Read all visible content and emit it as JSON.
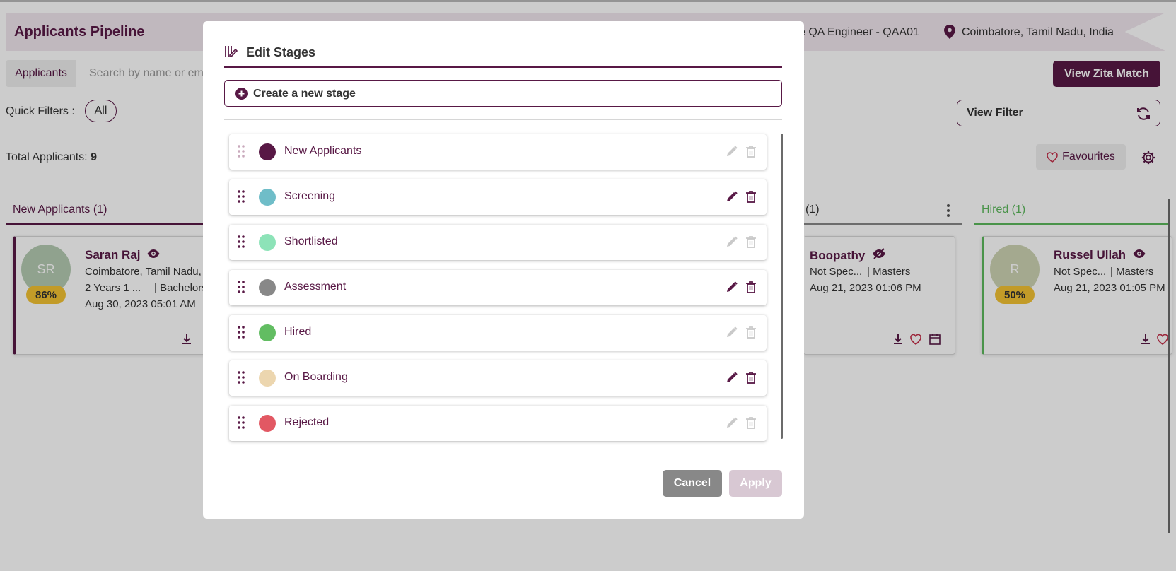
{
  "header": {
    "title": "Applicants Pipeline",
    "job": "e QA Engineer - QAA01",
    "location": "Coimbatore, Tamil Nadu, India"
  },
  "toolbar": {
    "tab": "Applicants",
    "search_placeholder": "Search by name or em",
    "view_zita_match": "View Zita Match",
    "quick_filters_label": "Quick Filters :",
    "quick_filter_all": "All",
    "view_filter": "View Filter",
    "total_label": "Total Applicants:",
    "total_count": "9",
    "favourites": "Favourites"
  },
  "columns": [
    {
      "label": "New Applicants (1)",
      "color": "#581845"
    },
    {
      "label": "(1)",
      "color": "#888888"
    },
    {
      "label": "Hired (1)",
      "color": "#5cb85c"
    }
  ],
  "cards": [
    {
      "initials": "SR",
      "score": "86%",
      "name": "Saran Raj",
      "line1": "Coimbatore, Tamil Nadu,",
      "line2": "2 Years 1 ...",
      "line2b": "| Bachelors",
      "date": "Aug 30, 2023 05:01 AM"
    },
    {
      "name": "Boopathy",
      "line1": "Not Spec...",
      "line1b": "| Masters",
      "date": "Aug 21, 2023 01:06 PM"
    },
    {
      "initials": "R",
      "score": "50%",
      "name": "Russel Ullah",
      "line1": "Not Spec...",
      "line1b": "| Masters",
      "date": "Aug 21, 2023 01:05 PM"
    }
  ],
  "modal": {
    "title": "Edit Stages",
    "create_label": "Create a new stage",
    "cancel": "Cancel",
    "apply": "Apply",
    "stages": [
      {
        "label": "New Applicants",
        "color": "#581845",
        "editable": false
      },
      {
        "label": "Screening",
        "color": "#6fbdc8",
        "editable": true
      },
      {
        "label": "Shortlisted",
        "color": "#8de3b8",
        "editable": false
      },
      {
        "label": "Assessment",
        "color": "#888888",
        "editable": true
      },
      {
        "label": "Hired",
        "color": "#62bd62",
        "editable": false
      },
      {
        "label": "On Boarding",
        "color": "#ecd6af",
        "editable": true
      },
      {
        "label": "Rejected",
        "color": "#e25863",
        "editable": false
      }
    ]
  }
}
